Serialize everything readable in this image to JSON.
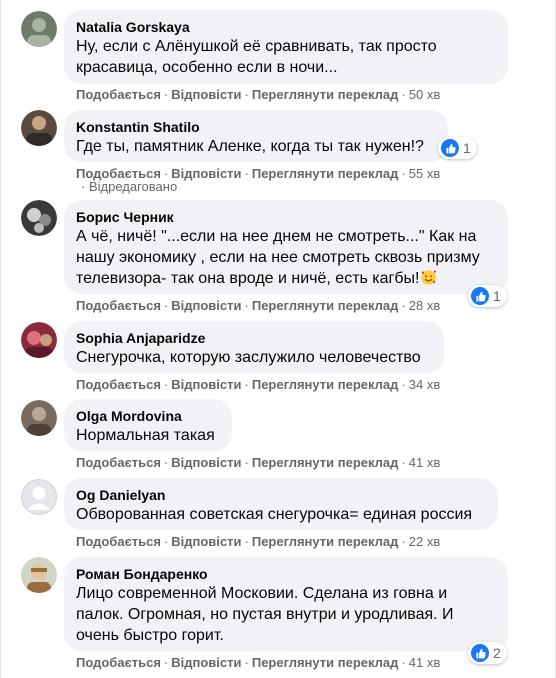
{
  "actions": {
    "like": "Подобається",
    "reply": "Відповісти",
    "translate": "Переглянути переклад",
    "separator": "·"
  },
  "comments": [
    {
      "author": "Natalia Gorskaya",
      "lines": [
        "Ну, если с Алёнушкой её сравнивать, так просто",
        "красавица, особенно если в ночи..."
      ],
      "time": "50 хв",
      "avatar_colors": [
        "#6f7a6b",
        "#a8b3a0"
      ]
    },
    {
      "author": "Konstantin Shatilo",
      "lines": [
        "Где ты, памятник Аленке, когда ты так нужен!?"
      ],
      "time": "55 хв",
      "edited": "Відредаговано",
      "reactions": "1",
      "avatar_colors": [
        "#5b4a3d",
        "#c9a68a"
      ]
    },
    {
      "author": "Борис Черник",
      "lines": [
        "А чё, ничё! \"...если на нее днем не смотреть...\" Как на",
        "нашу экономику , если на нее смотреть сквозь призму",
        "телевизора- так она вроде и ничё, есть кагбы!"
      ],
      "time": "28 хв",
      "reactions": "1",
      "emoji": "smiling-face-with-hearts",
      "avatar_colors": [
        "#3a3a3a",
        "#d0d0d0"
      ]
    },
    {
      "author": "Sophia Anjaparidze",
      "lines": [
        "Снегурочка, которую заслужило человечество"
      ],
      "time": "34 хв",
      "avatar_colors": [
        "#8a2a3a",
        "#e07080"
      ]
    },
    {
      "author": "Olga Mordovina",
      "lines": [
        "Нормальная такая"
      ],
      "time": "41 хв",
      "avatar_colors": [
        "#7a6a5e",
        "#b9a89a"
      ]
    },
    {
      "author": "Og Danielyan",
      "lines": [
        "Обворованная советская снегурочка= единая россия"
      ],
      "time": "22 хв",
      "avatar_colors": [
        "#c8ccd1",
        "#ffffff"
      ]
    },
    {
      "author": "Роман Бондаренко",
      "lines": [
        "Лицо современной Московии. Сделана из говна и",
        "палок. Огромная, но пустая внутри и уродливая. И",
        "очень быстро горит."
      ],
      "time": "41 хв",
      "reactions": "2",
      "avatar_colors": [
        "#9a6a40",
        "#e2c49a"
      ]
    }
  ]
}
